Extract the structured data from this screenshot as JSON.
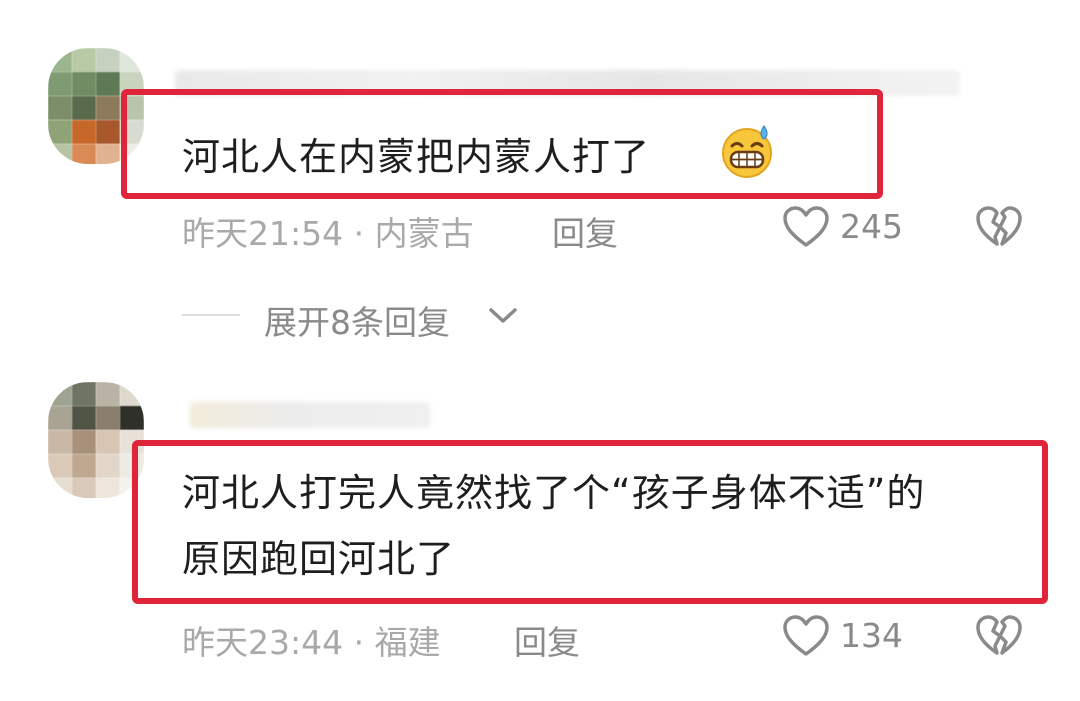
{
  "comments": [
    {
      "text_lines": [
        "河北人在内蒙把内蒙人打了"
      ],
      "emoji": "grinning-sweat-emoji",
      "time": "昨天21:54",
      "sep": "·",
      "location": "内蒙古",
      "reply_label": "回复",
      "likes": "245"
    },
    {
      "text_lines": [
        "河北人打完人竟然找了个“孩子身体不适”的",
        "原因跑回河北了"
      ],
      "time": "昨天23:44",
      "sep": "·",
      "location": "福建",
      "reply_label": "回复",
      "likes": "134"
    }
  ],
  "expand": {
    "label": "展开8条回复"
  },
  "colors": {
    "highlight": "#e0243a",
    "text": "#1e1e1e",
    "meta": "#a9a9a9"
  }
}
